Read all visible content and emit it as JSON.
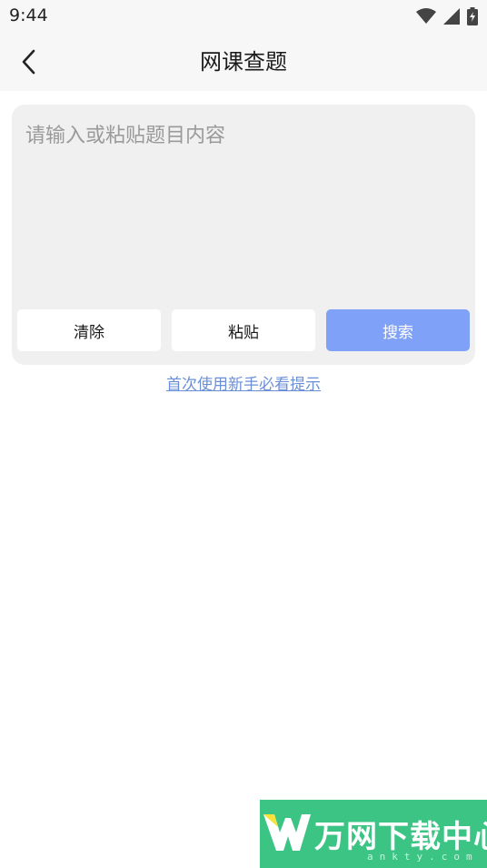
{
  "status_bar": {
    "time": "9:44",
    "icons": [
      "wifi-icon",
      "signal-icon",
      "battery-icon"
    ]
  },
  "app_bar": {
    "title": "网课查题",
    "back_icon": "chevron-left-icon"
  },
  "query": {
    "placeholder": "请输入或粘贴题目内容",
    "value": "",
    "clear_label": "清除",
    "paste_label": "粘贴",
    "search_label": "搜索"
  },
  "tips_link": "首次使用新手必看提示",
  "watermark": {
    "title": "万网下载中心",
    "sub": "ankty.com"
  },
  "colors": {
    "accent": "#7fa1f7",
    "link": "#6b8fd6",
    "card": "#f0f0f0",
    "bar": "#f7f7f7",
    "watermark": "#3cc485"
  }
}
